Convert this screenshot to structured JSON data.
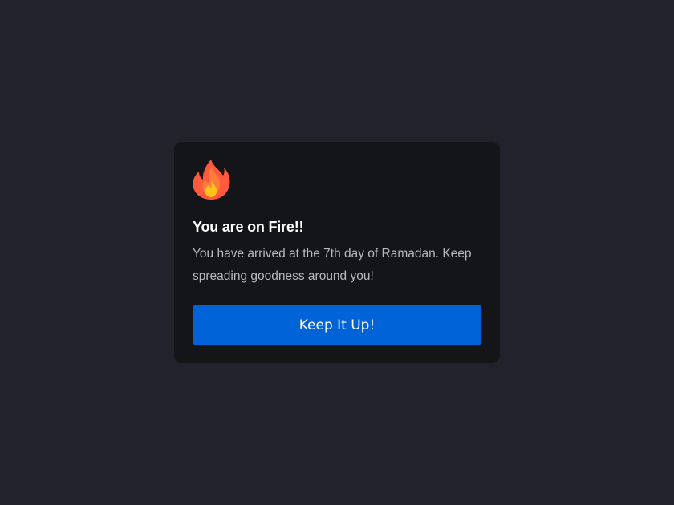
{
  "card": {
    "icon": "fire-icon",
    "title": "You are on Fire!!",
    "message": "You have arrived at the 7th day of Ramadan. Keep spreading goodness around you!",
    "button_label": "Keep It Up!"
  },
  "colors": {
    "page_background": "#21222b",
    "card_background": "#141518",
    "accent": "#0064d8",
    "flame_outer": "#ff5a3c",
    "flame_inner": "#ffc21a"
  }
}
